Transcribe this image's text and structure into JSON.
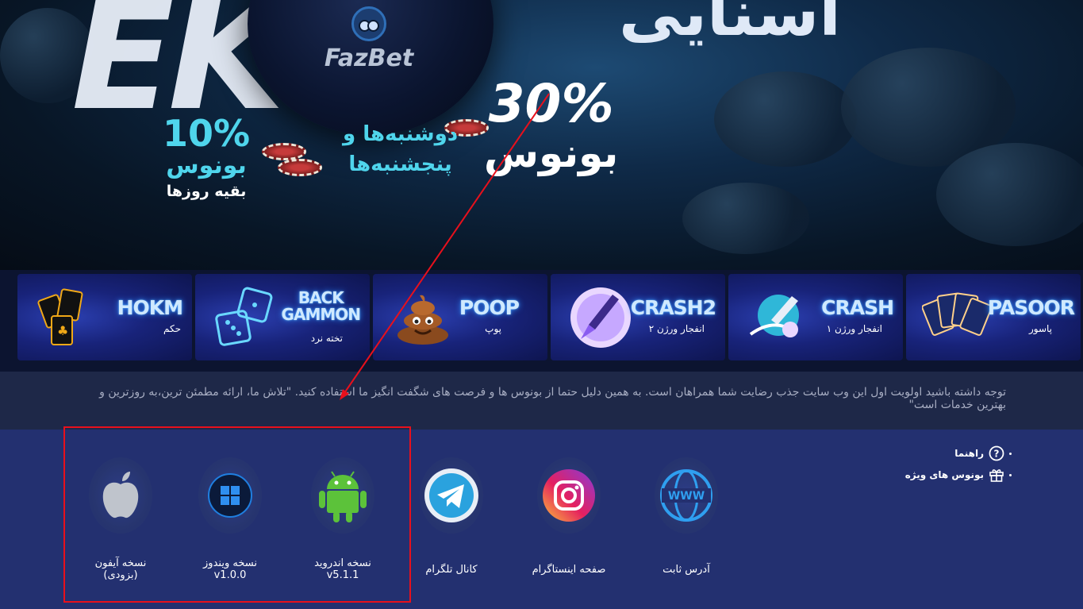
{
  "hero": {
    "brand": "FazBet",
    "big_left": "EK",
    "big_right": "اسنایی",
    "bonus30_pct": "30%",
    "bonus30_label": "بونوس",
    "days_line1": "دوشنبه‌ها و",
    "days_line2": "پنجشنبه‌ها",
    "bonus10_pct": "10%",
    "bonus10_label": "بونوس",
    "bonus10_sub": "بقیه روزها"
  },
  "games": [
    {
      "en": "HOKM",
      "fa": "حکم",
      "icon": "cards-icon"
    },
    {
      "en": "BACK\nGAMMON",
      "fa": "تخته نرد",
      "icon": "dice-icon"
    },
    {
      "en": "POOP",
      "fa": "پوپ",
      "icon": "poop-icon"
    },
    {
      "en": "CRASH2",
      "fa": "انفجار ورژن ۲",
      "icon": "rocket-icon"
    },
    {
      "en": "CRASH",
      "fa": "انفجار ورژن ۱",
      "icon": "rocket-icon"
    },
    {
      "en": "PASOOR",
      "fa": "پاسور",
      "icon": "cards-icon"
    }
  ],
  "notice": {
    "text": "توجه داشته باشید اولویت اول این وب سایت جذب رضایت شما همراهان است. به همین دلیل حتما از بونوس ها و فرصت های شگفت انگیز ما استفاده کنید. \"تلاش ما، ارائه مطمئن ترین،به روزترین و بهترین خدمات است\""
  },
  "apps": {
    "iphone_label": "نسخه آیفون",
    "iphone_sub": "(بزودی)",
    "windows_label": "نسخه ویندوز",
    "windows_ver": "v1.0.0",
    "android_label": "نسخه اندروید",
    "android_ver": "v5.1.1",
    "telegram_label": "کانال تلگرام",
    "instagram_label": "صفحه اینستاگرام",
    "address_label": "آدرس ثابت"
  },
  "side_links": {
    "guide": "راهنما",
    "bonuses": "بونوس های ویژه"
  },
  "colors": {
    "footer_bg": "#233070",
    "notice_bg": "#1e2848",
    "accent_cyan": "#4fd5ec",
    "highlight_red": "#e8101c"
  }
}
